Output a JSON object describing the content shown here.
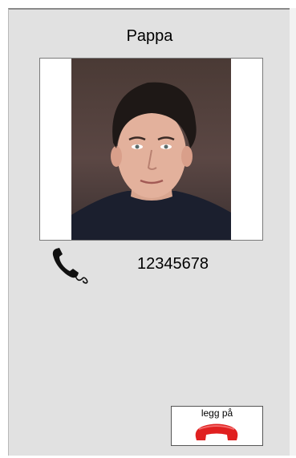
{
  "contact": {
    "name": "Pappa",
    "number": "12345678"
  },
  "actions": {
    "hangup_label": "legg på"
  },
  "icons": {
    "call": "phone-handset-icon",
    "hangup": "hangup-handset-icon"
  },
  "colors": {
    "window_bg": "#e1e1e1",
    "hangup_red": "#e02020"
  }
}
